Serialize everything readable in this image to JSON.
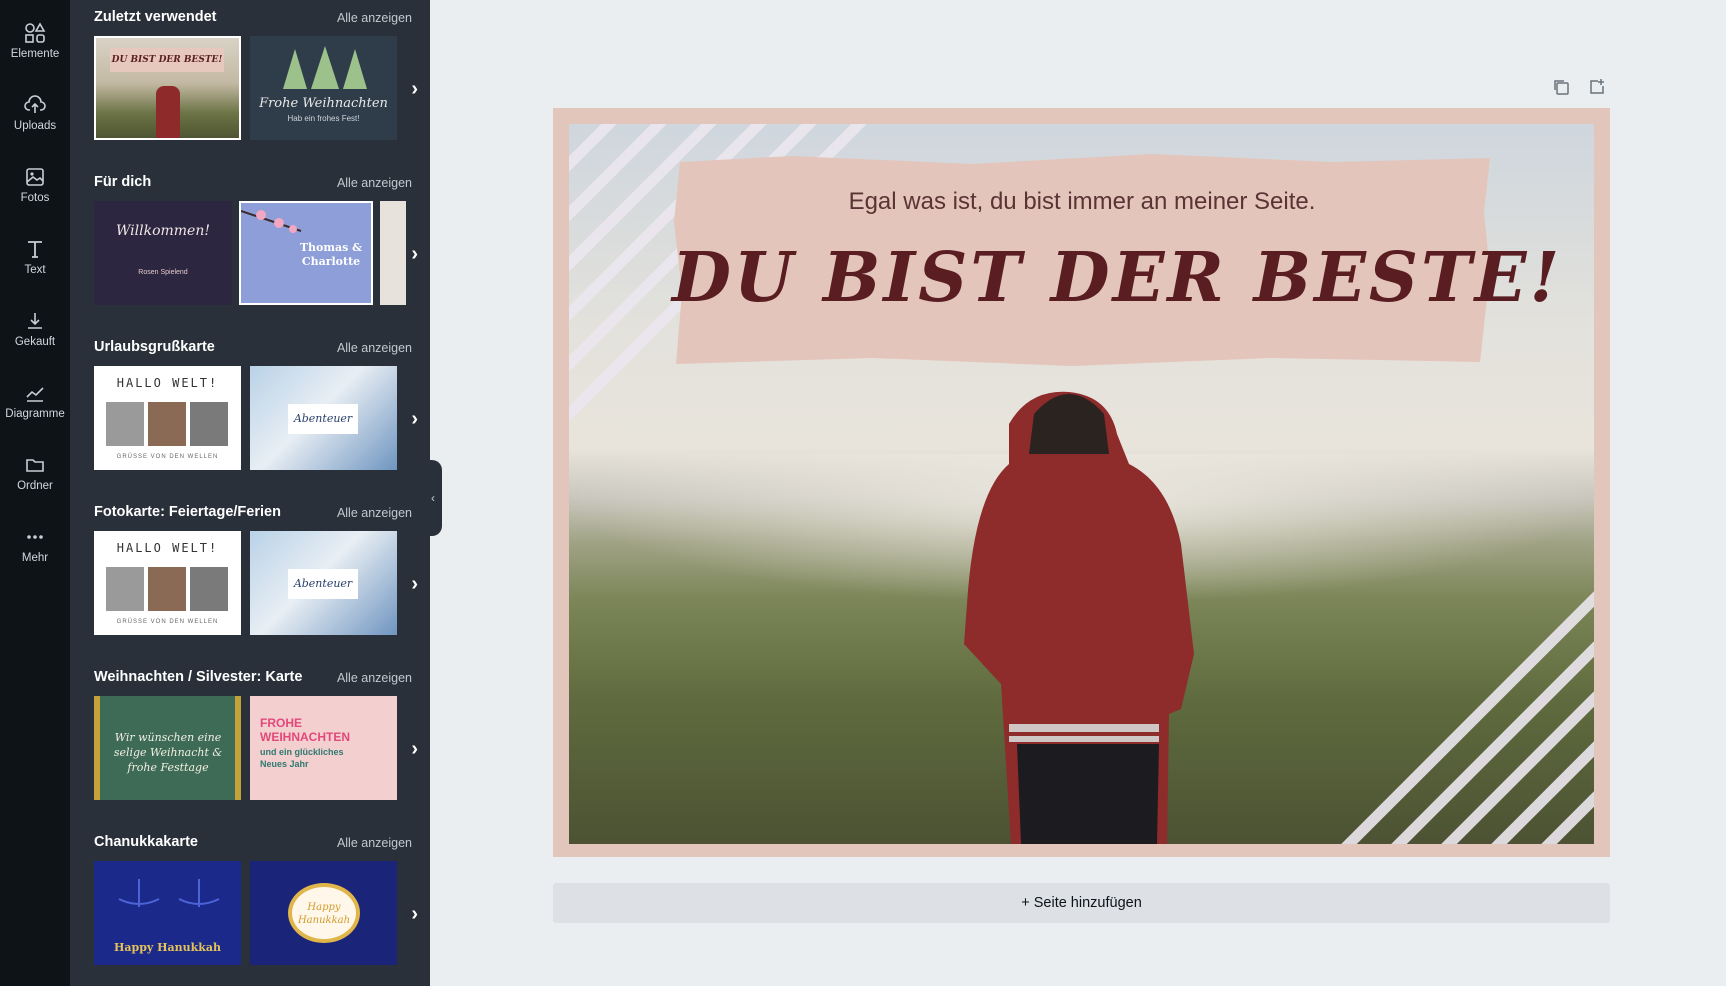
{
  "sidebar": {
    "items": [
      {
        "label": "Elemente",
        "icon": "elements-icon"
      },
      {
        "label": "Uploads",
        "icon": "upload-cloud-icon"
      },
      {
        "label": "Fotos",
        "icon": "photo-icon"
      },
      {
        "label": "Text",
        "icon": "text-icon"
      },
      {
        "label": "Gekauft",
        "icon": "download-icon"
      },
      {
        "label": "Diagramme",
        "icon": "chart-icon"
      },
      {
        "label": "Ordner",
        "icon": "folder-icon"
      },
      {
        "label": "Mehr",
        "icon": "more-icon"
      }
    ]
  },
  "panel": {
    "see_all": "Alle anzeigen",
    "sections": [
      {
        "title": "Zuletzt verwendet",
        "thumbs": [
          {
            "text": "DU BIST DER BESTE!",
            "sub": "Egal was ist, du bist immer an meiner Seite."
          },
          {
            "text": "Frohe Weihnachten",
            "sub": "Hab ein frohes Fest!"
          }
        ]
      },
      {
        "title": "Für dich",
        "thumbs": [
          {
            "text": "Willkommen!",
            "sub": "Rosen Spielend"
          },
          {
            "text": "Thomas & Charlotte",
            "sub": ""
          }
        ]
      },
      {
        "title": "Urlaubsgrußkarte",
        "thumbs": [
          {
            "text": "HALLO WELT!",
            "sub": "GRÜSSE VON DEN WELLEN"
          },
          {
            "text": "Abenteuer",
            "sub": ""
          }
        ]
      },
      {
        "title": "Fotokarte: Feiertage/Ferien",
        "thumbs": [
          {
            "text": "HALLO WELT!",
            "sub": "GRÜSSE VON DEN WELLEN"
          },
          {
            "text": "Abenteuer",
            "sub": ""
          }
        ]
      },
      {
        "title": "Weihnachten / Silvester: Karte",
        "thumbs": [
          {
            "text": "Wir wünschen eine selige Weihnacht & frohe Festtage",
            "sub": ""
          },
          {
            "text": "FROHE WEIHNACHTEN",
            "sub": "und ein glückliches Neues Jahr"
          }
        ]
      },
      {
        "title": "Chanukkakarte",
        "thumbs": [
          {
            "text": "Happy Hanukkah",
            "sub": ""
          },
          {
            "text": "Happy Hanukkah",
            "sub": ""
          }
        ]
      }
    ]
  },
  "canvas": {
    "subtitle": "Egal was ist, du bist immer an meiner Seite.",
    "title": "DU BIST DER BESTE!",
    "add_page": "+ Seite hinzufügen"
  },
  "colors": {
    "rail": "#0e1318",
    "panel": "#293039",
    "frame": "#e2c6bb",
    "title": "#5a1e22"
  }
}
